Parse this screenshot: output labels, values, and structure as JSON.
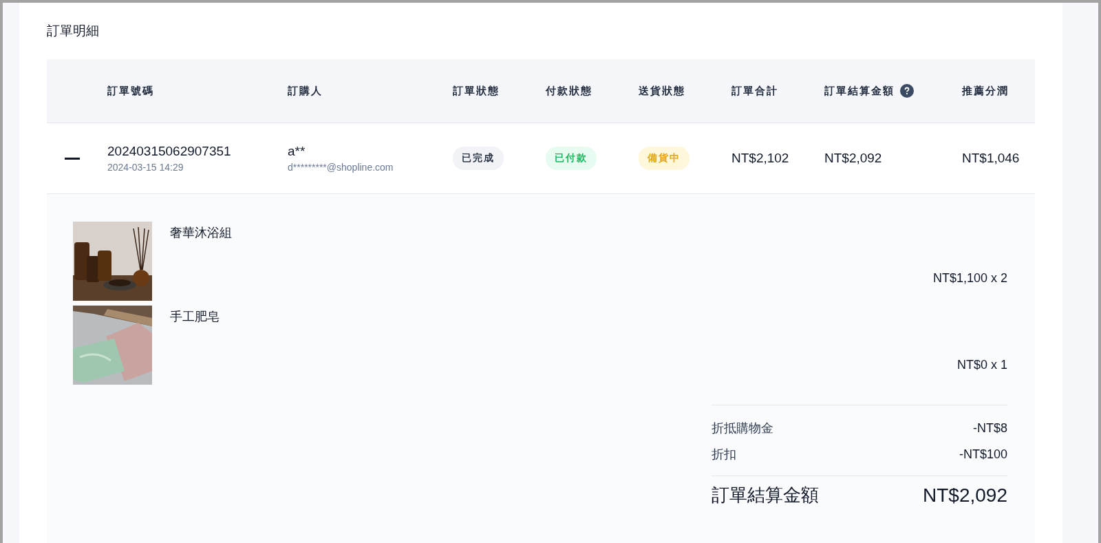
{
  "title": "訂單明細",
  "table": {
    "columns": [
      {
        "label": "訂單號碼",
        "help": false
      },
      {
        "label": "訂購人",
        "help": false
      },
      {
        "label": "訂單狀態",
        "help": false
      },
      {
        "label": "付款狀態",
        "help": false
      },
      {
        "label": "送貨狀態",
        "help": false
      },
      {
        "label": "訂單合計",
        "help": false
      },
      {
        "label": "訂單結算金額",
        "help": true
      },
      {
        "label": "推薦分潤",
        "help": false
      }
    ],
    "rows": [
      {
        "expanded": true,
        "order_no": "20240315062907351",
        "date": "2024-03-15 14:29",
        "buyer": "a**",
        "email": "d*********@shopline.com",
        "order_status": {
          "label": "已完成",
          "kind": "neutral"
        },
        "payment_status": {
          "label": "已付款",
          "kind": "success"
        },
        "delivery_status": {
          "label": "備貨中",
          "kind": "warning"
        },
        "total": "NT$2,102",
        "settlement": "NT$2,092",
        "referral": "NT$1,046",
        "details": {
          "items": [
            {
              "name": "奢華沐浴組",
              "price": "NT$1,100 x 2"
            },
            {
              "name": "手工肥皂",
              "price": "NT$0 x 1"
            }
          ],
          "adjustments": [
            {
              "label": "折抵購物金",
              "value": "-NT$8"
            },
            {
              "label": "折扣",
              "value": "-NT$100"
            }
          ],
          "grand_total": {
            "label": "訂單結算金額",
            "value": "NT$2,092"
          }
        }
      }
    ]
  }
}
